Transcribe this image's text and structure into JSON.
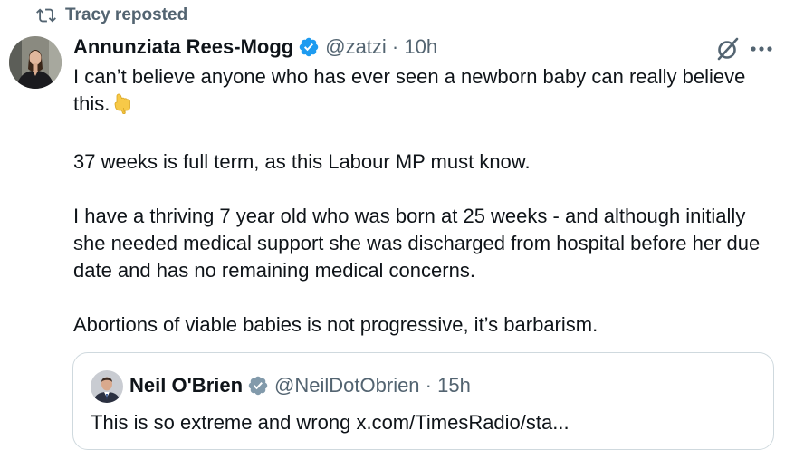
{
  "repost": {
    "label": "Tracy reposted",
    "icon": "repost-icon"
  },
  "tweet": {
    "author_name": "Annunziata Rees-Mogg",
    "verified": true,
    "handle_meta": "@zatzi · 10h",
    "paragraphs": [
      "I can’t believe anyone who has ever seen a newborn baby can really believe this.",
      "37 weeks is full term, as this Labour MP must know.",
      "I have a thriving 7 year old who was born at 25 weeks - and although initially she needed medical support she was discharged from hospital before her due date and has no remaining medical concerns.",
      "Abortions of viable babies is not progressive, it’s barbarism."
    ],
    "emoji": "backhand-index-pointing-down"
  },
  "quote": {
    "author_name": "Neil O'Brien",
    "verified": true,
    "handle_meta": "@NeilDotObrien · 15h",
    "text": "This is so extreme and wrong x.com/TimesRadio/sta..."
  },
  "colors": {
    "primary_text": "#0f1419",
    "secondary_text": "#536471",
    "verified_blue": "#1d9bf0",
    "verified_gray": "#829aab",
    "border": "#cfd9de"
  }
}
